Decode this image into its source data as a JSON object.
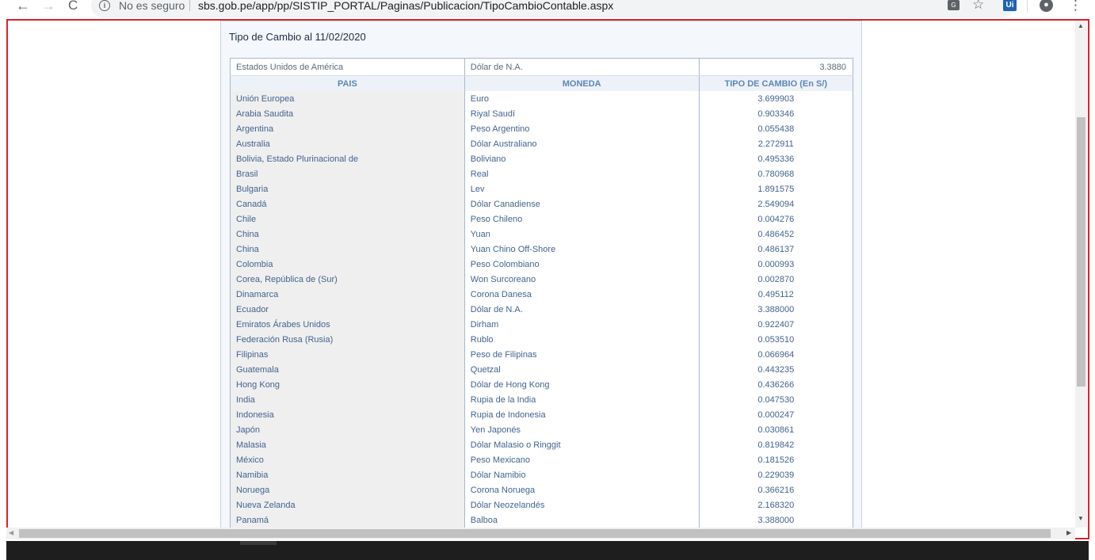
{
  "browser": {
    "back_glyph": "←",
    "forward_glyph": "→",
    "reload_glyph": "C",
    "security_label": "No es seguro",
    "url": "sbs.gob.pe/app/pp/SISTIP_PORTAL/Paginas/Publicacion/TipoCambioContable.aspx",
    "icons": [
      "back-icon",
      "forward-icon",
      "reload-icon",
      "info-icon",
      "translate-icon",
      "star-icon",
      "extension-icon",
      "profile-icon",
      "menu-icon"
    ],
    "extension_label": "Ui"
  },
  "page": {
    "title": "Tipo de Cambio al 11/02/2020",
    "top_row": {
      "pais": "Estados Unidos de América",
      "moneda": "Dólar de N.A.",
      "tipo_cambio": "3.3880"
    },
    "headers": {
      "pais": "PAIS",
      "moneda": "MONEDA",
      "tipo_cambio": "TIPO DE CAMBIO (En S/)"
    },
    "rows": [
      {
        "pais": "Unión Europea",
        "moneda": "Euro",
        "tc": "3.699903"
      },
      {
        "pais": "Arabia Saudita",
        "moneda": "Riyal Saudí",
        "tc": "0.903346"
      },
      {
        "pais": "Argentina",
        "moneda": "Peso Argentino",
        "tc": "0.055438"
      },
      {
        "pais": "Australia",
        "moneda": "Dólar Australiano",
        "tc": "2.272911"
      },
      {
        "pais": "Bolivia, Estado Plurinacional de",
        "moneda": "Boliviano",
        "tc": "0.495336"
      },
      {
        "pais": "Brasil",
        "moneda": "Real",
        "tc": "0.780968"
      },
      {
        "pais": "Bulgaria",
        "moneda": "Lev",
        "tc": "1.891575"
      },
      {
        "pais": "Canadá",
        "moneda": "Dólar Canadiense",
        "tc": "2.549094"
      },
      {
        "pais": "Chile",
        "moneda": "Peso Chileno",
        "tc": "0.004276"
      },
      {
        "pais": "China",
        "moneda": "Yuan",
        "tc": "0.486452"
      },
      {
        "pais": "China",
        "moneda": "Yuan Chino Off-Shore",
        "tc": "0.486137"
      },
      {
        "pais": "Colombia",
        "moneda": "Peso Colombiano",
        "tc": "0.000993"
      },
      {
        "pais": "Corea, República de (Sur)",
        "moneda": "Won Surcoreano",
        "tc": "0.002870"
      },
      {
        "pais": "Dinamarca",
        "moneda": "Corona Danesa",
        "tc": "0.495112"
      },
      {
        "pais": "Ecuador",
        "moneda": "Dólar de N.A.",
        "tc": "3.388000"
      },
      {
        "pais": "Emiratos Árabes Unidos",
        "moneda": "Dirham",
        "tc": "0.922407"
      },
      {
        "pais": "Federación Rusa (Rusia)",
        "moneda": "Rublo",
        "tc": "0.053510"
      },
      {
        "pais": "Filipinas",
        "moneda": "Peso de Filipinas",
        "tc": "0.066964"
      },
      {
        "pais": "Guatemala",
        "moneda": "Quetzal",
        "tc": "0.443235"
      },
      {
        "pais": "Hong Kong",
        "moneda": "Dólar de Hong Kong",
        "tc": "0.436266"
      },
      {
        "pais": "India",
        "moneda": "Rupia de la India",
        "tc": "0.047530"
      },
      {
        "pais": "Indonesia",
        "moneda": "Rupia de Indonesia",
        "tc": "0.000247"
      },
      {
        "pais": "Japón",
        "moneda": "Yen Japonés",
        "tc": "0.030861"
      },
      {
        "pais": "Malasia",
        "moneda": "Dólar Malasio o Ringgit",
        "tc": "0.819842"
      },
      {
        "pais": "México",
        "moneda": "Peso Mexicano",
        "tc": "0.181526"
      },
      {
        "pais": "Namibia",
        "moneda": "Dólar Namibio",
        "tc": "0.229039"
      },
      {
        "pais": "Noruega",
        "moneda": "Corona Noruega",
        "tc": "0.366216"
      },
      {
        "pais": "Nueva Zelanda",
        "moneda": "Dólar Neozelandés",
        "tc": "2.168320"
      },
      {
        "pais": "Panamá",
        "moneda": "Balboa",
        "tc": "3.388000"
      }
    ]
  },
  "colors": {
    "highlight_frame": "#d9232a",
    "header_text": "#5c86b9",
    "cell_text": "#42638f",
    "panel_background": "#f4f7fb"
  }
}
